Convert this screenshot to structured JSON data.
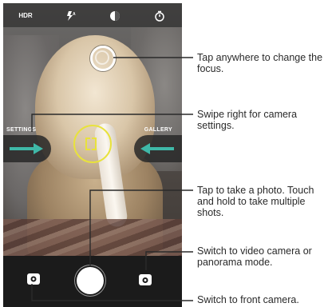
{
  "top_bar": {
    "hdr_label": "HDR",
    "items": [
      {
        "name": "hdr-icon"
      },
      {
        "name": "flash-auto-icon"
      },
      {
        "name": "exposure-icon"
      },
      {
        "name": "timer-icon"
      }
    ]
  },
  "drawers": {
    "settings_label": "SETTINGS",
    "gallery_label": "GALLERY"
  },
  "colors": {
    "arrow_accent": "#3fb8a8",
    "reticle": "#e8e23c"
  },
  "callouts": {
    "focus": "Tap anywhere to change the focus.",
    "settings": "Swipe right for camera settings.",
    "photo": "Tap to take a photo. Touch and hold to take multiple shots.",
    "video": "Switch to video camera or panorama mode.",
    "front": "Switch to front camera."
  }
}
